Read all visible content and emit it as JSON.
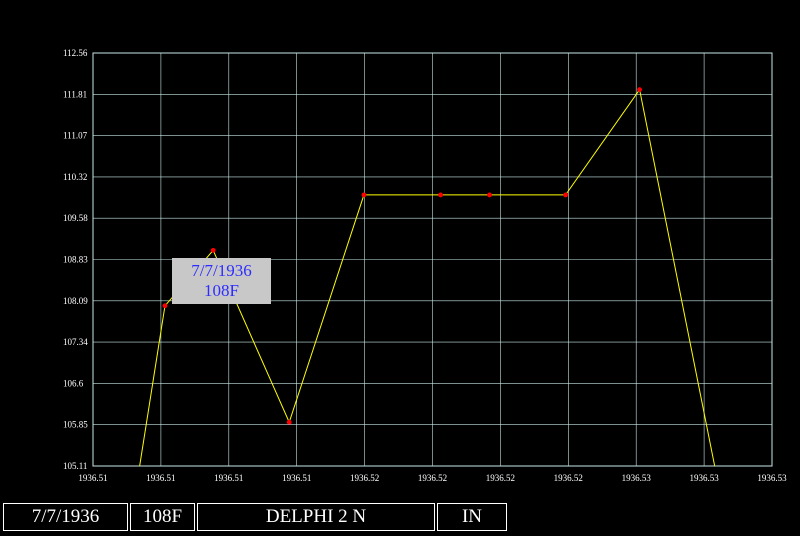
{
  "chart_data": {
    "type": "line",
    "x": [
      "1936.51",
      "1936.51",
      "1936.51",
      "1936.52",
      "1936.52",
      "1936.52",
      "1936.52",
      "1936.53",
      "1936.53"
    ],
    "values": [
      104.9,
      108.0,
      109.0,
      105.9,
      110.0,
      110.0,
      110.0,
      110.0,
      111.9,
      104.9
    ],
    "y_ticks": [
      "112.56",
      "111.81",
      "111.07",
      "110.32",
      "109.58",
      "108.83",
      "108.09",
      "107.34",
      "106.6",
      "105.85",
      "105.11"
    ],
    "x_ticks": [
      "1936.51",
      "1936.51",
      "1936.51",
      "1936.51",
      "1936.52",
      "1936.52",
      "1936.52",
      "1936.52",
      "1936.53",
      "1936.53",
      "1936.53"
    ],
    "ylim": [
      105.11,
      112.56
    ],
    "grid": true,
    "line_color": "#ffff00",
    "marker_color": "#ff0000",
    "grid_color": "#c8e8e8"
  },
  "tooltip": {
    "date": "7/7/1936",
    "value": "108F"
  },
  "status": {
    "date": "7/7/1936",
    "temp": "108F",
    "station": "DELPHI 2 N",
    "state": "IN"
  }
}
